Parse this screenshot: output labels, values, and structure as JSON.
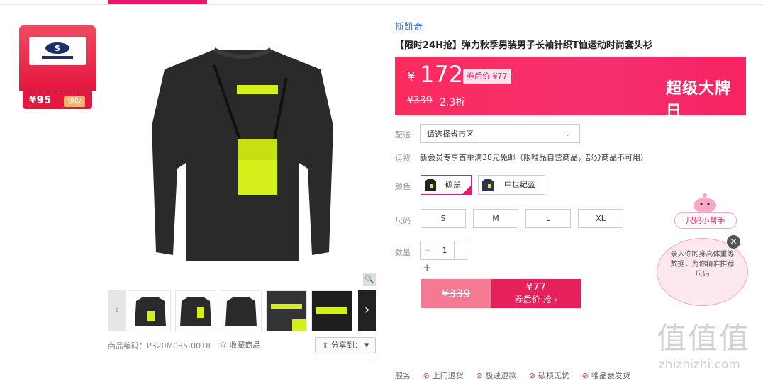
{
  "coupon": {
    "price": "¥95",
    "get_label": "领取"
  },
  "brand_name": "斯凯奇",
  "product_title": "【限时24H抢】弹力秋季男装男子长袖针织T恤运动时尚套头衫",
  "price": {
    "currency": "¥",
    "current": "172",
    "after_coupon": "券后价 ¥77",
    "original": "¥339",
    "discount": "2.3折",
    "slogan": "超级大牌日"
  },
  "delivery": {
    "label": "配送",
    "placeholder": "请选择省市区"
  },
  "shipping": {
    "label": "运费",
    "text": "新会员专享首单满38元免邮（限唯品自营商品，部分商品不可用）"
  },
  "colors": {
    "label": "颜色",
    "options": [
      {
        "name": "碳黑",
        "selected": true
      },
      {
        "name": "中世纪蓝",
        "selected": false
      }
    ]
  },
  "sizes": {
    "label": "尺码",
    "options": [
      "S",
      "M",
      "L",
      "XL"
    ]
  },
  "quantity": {
    "label": "数量",
    "value": "1",
    "minus": "−",
    "plus": "+"
  },
  "buy": {
    "orig_price": "¥339",
    "coupon_price": "¥77",
    "action": "券后价 抢 ›"
  },
  "gallery": {
    "prev": "‹",
    "next": "›",
    "zoom": "🔍"
  },
  "product_code": "商品编码：P320M035-0018",
  "favorite": "收藏商品",
  "share": "分享到：",
  "services": {
    "label": "服务",
    "items": [
      "上门退货",
      "极速退款",
      "破损无忧",
      "唯品会发货"
    ]
  },
  "size_helper": {
    "button": "尺码小帮手",
    "tip": "录入你的身高体重等数据，为你精准推荐尺码",
    "close": "✕"
  },
  "watermark": {
    "text": "值值值",
    "url": "zhizhizhi.com"
  },
  "colors_hex": {
    "accent": "#e6196e",
    "price_bg": "#fb2c5e",
    "link": "#3366cc",
    "highlight": "#d4ef1a"
  }
}
